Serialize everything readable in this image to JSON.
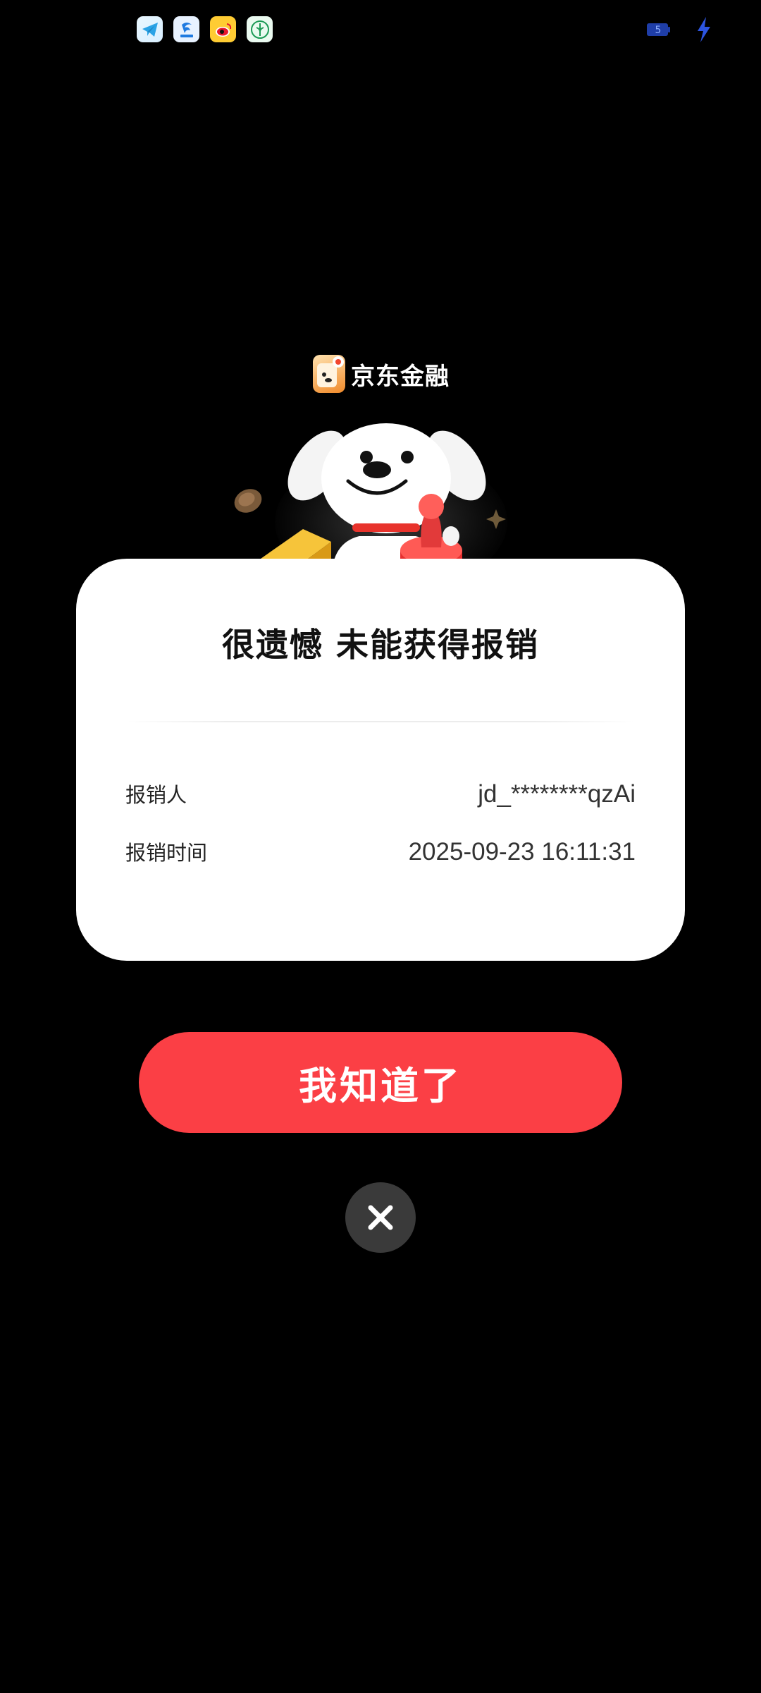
{
  "status_bar": {
    "notification_icons": [
      "telegram-icon",
      "china-telecom-icon",
      "weibo-icon",
      "farm-app-icon"
    ],
    "battery_level": "5"
  },
  "brand": {
    "name": "京东金融"
  },
  "card": {
    "title": "很遗憾 未能获得报销",
    "rows": [
      {
        "label": "报销人",
        "value": "jd_********qzAi"
      },
      {
        "label": "报销时间",
        "value": "2025-09-23 16:11:31"
      }
    ]
  },
  "actions": {
    "confirm_label": "我知道了",
    "close_icon": "close-icon"
  },
  "colors": {
    "background": "#000000",
    "accent": "#fb3f45",
    "card": "#ffffff",
    "close_bg": "#3a3a3a"
  }
}
